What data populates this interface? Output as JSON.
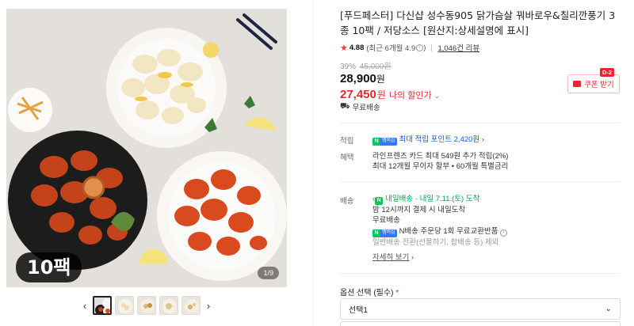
{
  "gallery": {
    "badge": "10팩",
    "page_indicator": "1/9",
    "prev_icon": "chevron-left-icon",
    "next_icon": "chevron-right-icon",
    "thumbnail_count": 5
  },
  "product": {
    "title": "[푸드페스터] 다신샵 성수동905 닭가슴살 꿔바로우&칠리깐풍기 3종 10팩 / 저당소스 [원산지:상세설명에 표시]",
    "rating": "4.88",
    "rating_recent": "(최근 6개월 4.9",
    "rating_recent_end": ")",
    "reviews": "1,046건 리뷰"
  },
  "price": {
    "discount_rate": "39%",
    "original_price": "45,000원",
    "price": "28,900",
    "price_unit": "원",
    "my_price": "27,450",
    "my_price_unit": "원",
    "my_price_label": "나의 할인가"
  },
  "coupon": {
    "label": "쿠폰 받기",
    "dday": "D-2"
  },
  "shipping_summary": "무료배송",
  "points": {
    "label": "적립",
    "text": "최대 적립 포인트 2,420원",
    "badge_n": "N",
    "badge_m": "멤버십"
  },
  "benefits": {
    "label": "혜택",
    "line1": "라인프렌즈 카드 최대 549원 추가 적립(2%)",
    "line2": "최대 12개월 무이자 할부 • 60개월 특별금리"
  },
  "delivery": {
    "label": "배송",
    "arrival_badge": "내일배송",
    "arrival_text": "· 내일 7.11.(토) 도착",
    "cutoff": "밤 12시까지 결제 시 내일도착",
    "fee": "무료배송",
    "exchange": "N배송 주문당 1회 무료교환반품",
    "exclusion": "일반배송 전환(선물하기, 합배송 등) 제외",
    "more": "자세히 보기"
  },
  "option": {
    "label": "옵션 선택 (필수)",
    "required_mark": "*",
    "selected": "선택1"
  },
  "colors": {
    "accent_red": "#e8262d",
    "naver_green": "#03c75a",
    "link_blue": "#1b55f3"
  }
}
